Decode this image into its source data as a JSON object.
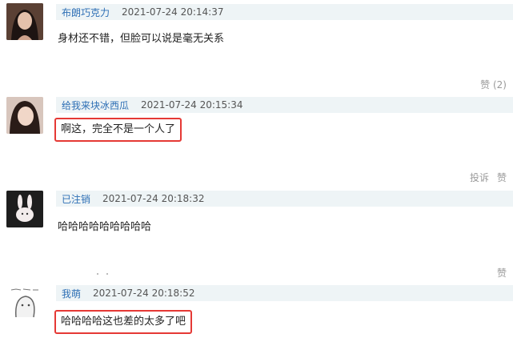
{
  "comments": [
    {
      "username": "布朗巧克力",
      "timestamp": "2021-07-24 20:14:37",
      "text": "身材还不错，但脸可以说是毫无关系",
      "like_label": "赞 (2)"
    },
    {
      "username": "给我来块冰西瓜",
      "timestamp": "2021-07-24 20:15:34",
      "text": "啊这，完全不是一个人了",
      "report_label": "投诉",
      "like_label": "赞"
    },
    {
      "username": "已注销",
      "timestamp": "2021-07-24 20:18:32",
      "text": "哈哈哈哈哈哈哈哈哈",
      "like_label": "赞"
    },
    {
      "username": "我萌",
      "timestamp": "2021-07-24 20:18:52",
      "text": "哈哈哈哈这也差的太多了吧"
    }
  ],
  "colors": {
    "username": "#2e6fb5",
    "header_bg": "#eef4f6",
    "highlight_border": "#e53935",
    "action_text": "#9a9a9a"
  }
}
